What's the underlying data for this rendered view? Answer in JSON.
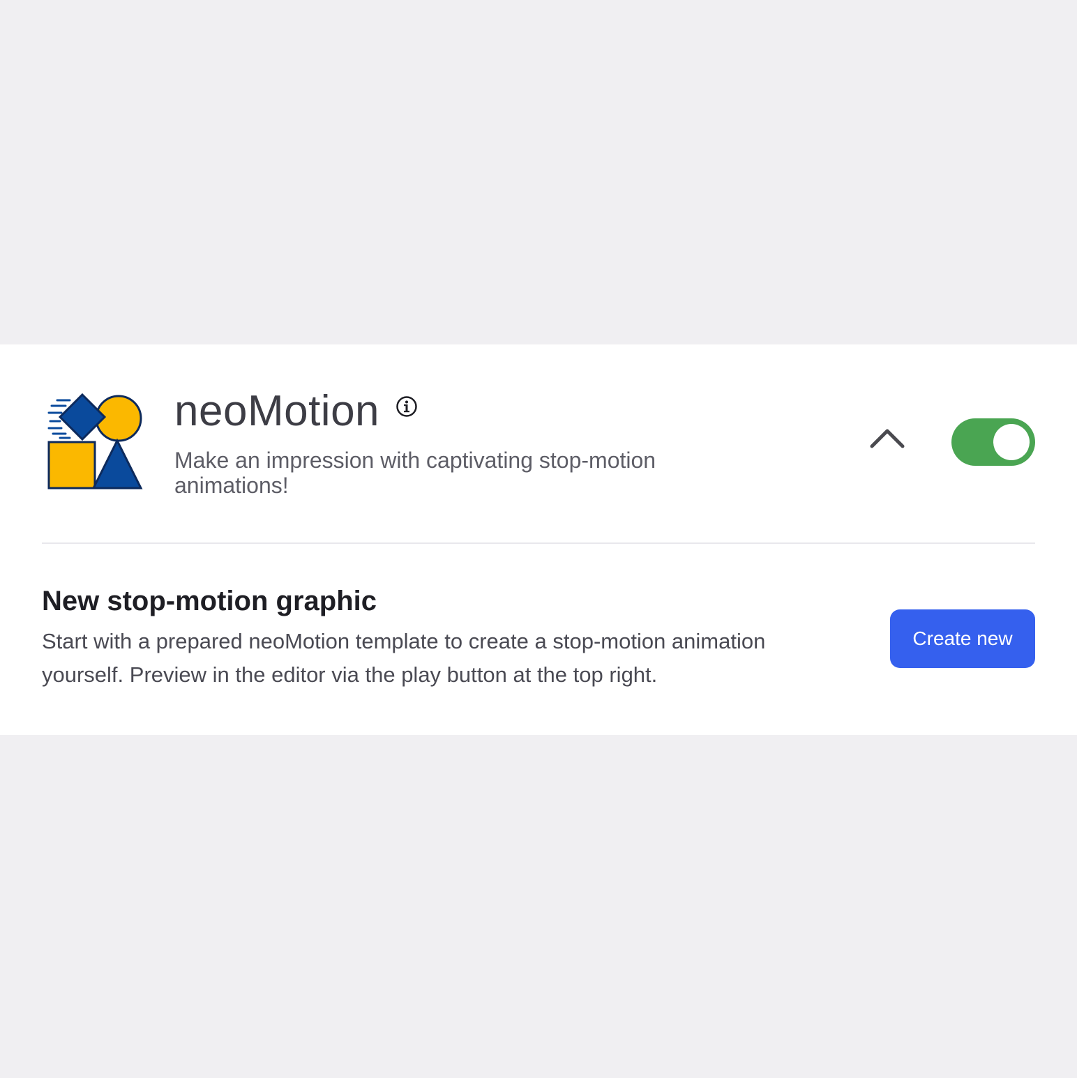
{
  "app": {
    "title": "neoMotion",
    "description": "Make an impression with captivating stop-motion animations!",
    "logo_icon": "shapes-logo-icon",
    "info_icon": "info-icon",
    "collapse_icon": "chevron-up-icon",
    "enabled": true
  },
  "section": {
    "title": "New stop-motion graphic",
    "description": "Start with a prepared neoMotion template to create a stop-motion animation yourself. Preview in the editor via the play button at the top right.",
    "button_label": "Create new"
  },
  "colors": {
    "background": "#f0eff2",
    "card": "#ffffff",
    "toggle_on": "#4aa552",
    "button": "#3560ee",
    "logo_yellow": "#fbb800",
    "logo_blue": "#0a4a9c"
  }
}
